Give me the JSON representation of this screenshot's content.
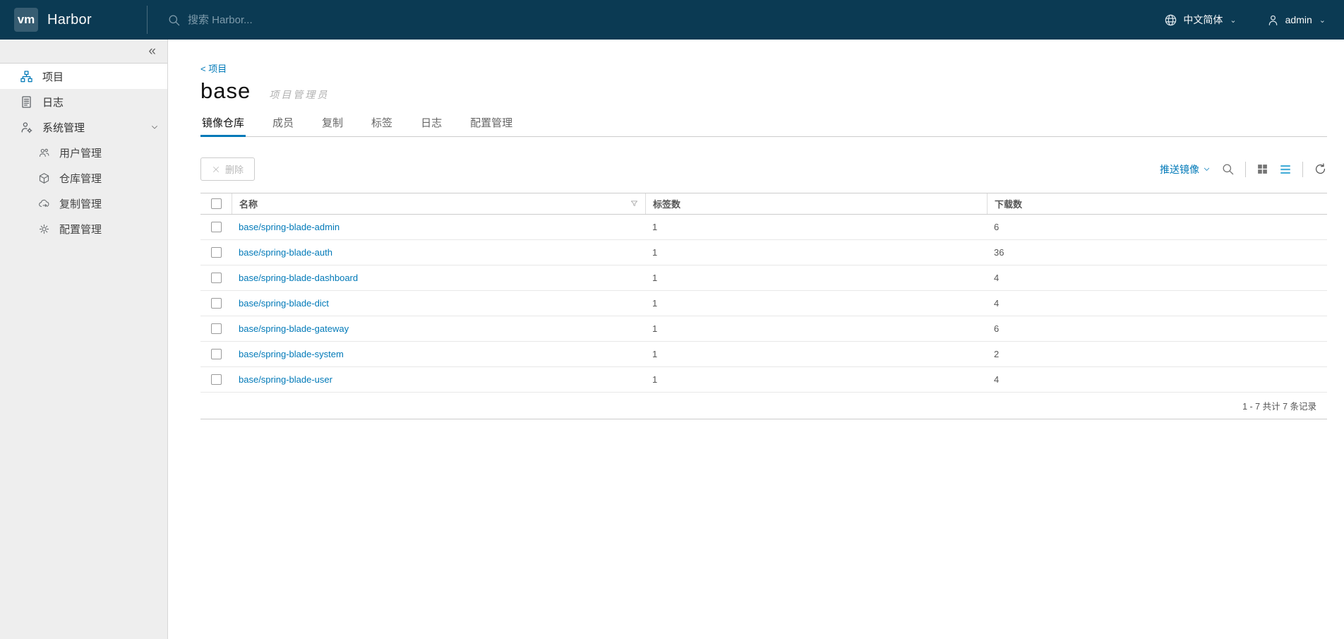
{
  "header": {
    "logo_text": "vm",
    "app_name": "Harbor",
    "search_placeholder": "搜索 Harbor...",
    "language_label": "中文简体",
    "user_label": "admin",
    "caret": "⌄"
  },
  "sidebar": {
    "collapse_glyph": "«",
    "items": [
      {
        "label": "项目"
      },
      {
        "label": "日志"
      },
      {
        "label": "系统管理"
      }
    ],
    "sub_items": [
      {
        "label": "用户管理"
      },
      {
        "label": "仓库管理"
      },
      {
        "label": "复制管理"
      },
      {
        "label": "配置管理"
      }
    ]
  },
  "main": {
    "breadcrumb": "< 项目",
    "title": "base",
    "role_badge": "项目管理员",
    "tabs": [
      "镜像仓库",
      "成员",
      "复制",
      "标签",
      "日志",
      "配置管理"
    ],
    "toolbar": {
      "delete_label": "删除",
      "push_image_label": "推送镜像"
    },
    "table": {
      "columns": {
        "name": "名称",
        "tags": "标签数",
        "downloads": "下载数"
      },
      "rows": [
        {
          "name": "base/spring-blade-admin",
          "tags": "1",
          "downloads": "6"
        },
        {
          "name": "base/spring-blade-auth",
          "tags": "1",
          "downloads": "36"
        },
        {
          "name": "base/spring-blade-dashboard",
          "tags": "1",
          "downloads": "4"
        },
        {
          "name": "base/spring-blade-dict",
          "tags": "1",
          "downloads": "4"
        },
        {
          "name": "base/spring-blade-gateway",
          "tags": "1",
          "downloads": "6"
        },
        {
          "name": "base/spring-blade-system",
          "tags": "1",
          "downloads": "2"
        },
        {
          "name": "base/spring-blade-user",
          "tags": "1",
          "downloads": "4"
        }
      ],
      "footer": "1 - 7 共计 7 条记录"
    }
  },
  "colors": {
    "header_bg": "#0b3a53",
    "accent_blue": "#0079b8",
    "active_view_icon": "#49afd9",
    "sidebar_bg": "#eeeeee"
  }
}
